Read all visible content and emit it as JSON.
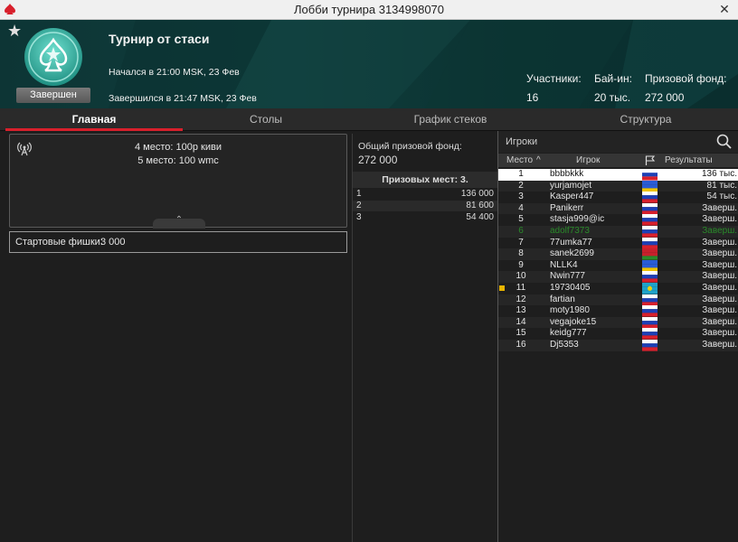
{
  "window": {
    "title": "Лобби турнира 3134998070",
    "close": "✕"
  },
  "header": {
    "name": "Турнир от стаси",
    "started": "Начался в 21:00 MSK, 23 Фев",
    "ended": "Завершился в 21:47 MSK, 23 Фев",
    "status": "Завершен",
    "stats": [
      {
        "label": "Участники:",
        "value": "16"
      },
      {
        "label": "Бай-ин:",
        "value": "20 тыс."
      },
      {
        "label": "Призовой фонд:",
        "value": "272 000"
      }
    ]
  },
  "tabs": [
    {
      "label": "Главная",
      "active": true
    },
    {
      "label": "Столы",
      "active": false
    },
    {
      "label": "График стеков",
      "active": false
    },
    {
      "label": "Структура",
      "active": false
    }
  ],
  "info": {
    "note_lines": [
      "4 место: 100р киви",
      "5 место: 100 wmc"
    ],
    "chips_label": "Стартовые фишки:",
    "chips_value": "3 000"
  },
  "prizes": {
    "pool_label": "Общий призовой фонд:",
    "pool_value": "272 000",
    "places_header": "Призовых мест: 3.",
    "rows": [
      {
        "place": "1",
        "amount": "136 000"
      },
      {
        "place": "2",
        "amount": "81 600"
      },
      {
        "place": "3",
        "amount": "54 400"
      }
    ]
  },
  "players": {
    "label": "Игроки",
    "columns": {
      "place": "Место",
      "sort": "^",
      "player": "Игрок",
      "results": "Результаты"
    },
    "rows": [
      {
        "place": "1",
        "name": "bbbbkkk",
        "result": "136 тыс.",
        "flag": "ru"
      },
      {
        "place": "2",
        "name": "yurjamojet",
        "result": "81 тыс.",
        "flag": "ua"
      },
      {
        "place": "3",
        "name": "Kasper447",
        "result": "54 тыс.",
        "flag": "ru"
      },
      {
        "place": "4",
        "name": "Panikerr",
        "result": "Заверш.",
        "flag": "ru"
      },
      {
        "place": "5",
        "name": "stasja999@ic",
        "result": "Заверш.",
        "flag": "ru"
      },
      {
        "place": "6",
        "name": "adolf7373",
        "result": "Заверш.",
        "flag": "ru"
      },
      {
        "place": "7",
        "name": "77umka77",
        "result": "Заверш.",
        "flag": "ru"
      },
      {
        "place": "8",
        "name": "sanek2699",
        "result": "Заверш.",
        "flag": "by"
      },
      {
        "place": "9",
        "name": "NLLK4",
        "result": "Заверш.",
        "flag": "ua"
      },
      {
        "place": "10",
        "name": "Nwin777",
        "result": "Заверш.",
        "flag": "ru"
      },
      {
        "place": "11",
        "name": "19730405",
        "result": "Заверш.",
        "flag": "kz"
      },
      {
        "place": "12",
        "name": "fartian",
        "result": "Заверш.",
        "flag": "ru"
      },
      {
        "place": "13",
        "name": "moty1980",
        "result": "Заверш.",
        "flag": "ru"
      },
      {
        "place": "14",
        "name": "vegajoke15",
        "result": "Заверш.",
        "flag": "ru"
      },
      {
        "place": "15",
        "name": "keidg777",
        "result": "Заверш.",
        "flag": "ru"
      },
      {
        "place": "16",
        "name": "Dj5353",
        "result": "Заверш.",
        "flag": "ru"
      }
    ]
  },
  "colors": {
    "accent": "#d8202c",
    "header_bg": "#0f3d3c",
    "highlight_name": "#2a8a2a",
    "marker": "#e8b400"
  },
  "icons": [
    "pokerstars-spade-icon",
    "star-icon",
    "close-icon",
    "broadcast-icon",
    "search-icon",
    "flag-icon",
    "chevron-up-icon"
  ]
}
